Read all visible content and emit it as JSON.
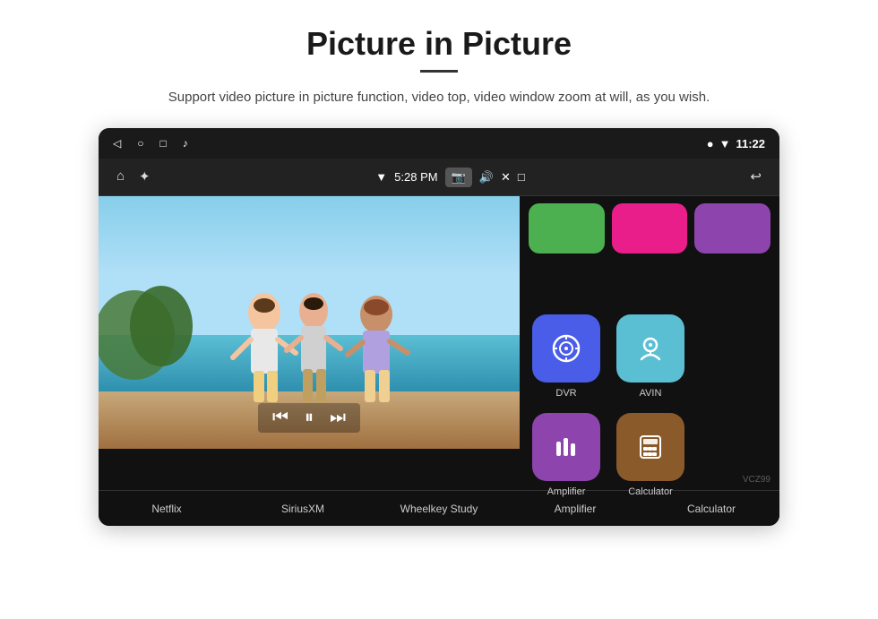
{
  "header": {
    "title": "Picture in Picture",
    "divider": true,
    "subtitle": "Support video picture in picture function, video top, video window zoom at will, as you wish."
  },
  "statusbar": {
    "back_icon": "◁",
    "home_icon": "○",
    "recents_icon": "□",
    "music_icon": "♪",
    "wifi_icon": "▾",
    "location_icon": "▾",
    "time": "11:22"
  },
  "navbar": {
    "home_icon": "⌂",
    "usb_icon": "⚡",
    "wifi_label": "▾",
    "time_label": "5:28 PM",
    "camera_label": "📷",
    "volume_icon": "🔊",
    "close_icon": "✕",
    "window_icon": "⊡",
    "back_icon": "↩"
  },
  "pip": {
    "minus": "−",
    "plus": "+",
    "close": "✕",
    "play_prev": "⏮",
    "play_pause": "⏸",
    "play_next": "⏭"
  },
  "apps": {
    "top_row": [
      {
        "color": "green",
        "label": ""
      },
      {
        "color": "pink",
        "label": ""
      },
      {
        "color": "purple",
        "label": ""
      }
    ],
    "main_row": [
      {
        "id": "dvr",
        "label": "DVR",
        "color": "dvr"
      },
      {
        "id": "avin",
        "label": "AVIN",
        "color": "avin"
      },
      {
        "id": "amplifier",
        "label": "Amplifier",
        "color": "amplifier"
      },
      {
        "id": "calculator",
        "label": "Calculator",
        "color": "calculator"
      }
    ]
  },
  "bottom_labels": [
    {
      "label": "Netflix"
    },
    {
      "label": "SiriusXM"
    },
    {
      "label": "Wheelkey Study"
    },
    {
      "label": "Amplifier"
    },
    {
      "label": "Calculator"
    }
  ],
  "watermark": "VCZ99"
}
